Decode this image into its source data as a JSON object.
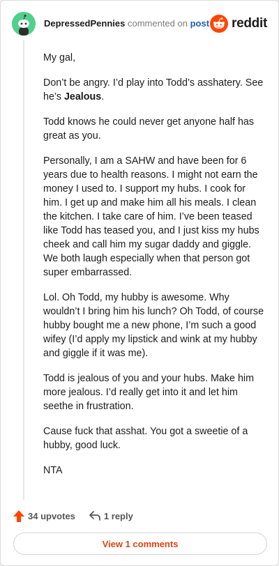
{
  "header": {
    "username": "DepressedPennies",
    "action_text": "commented on",
    "post_link": "post",
    "brand": "reddit"
  },
  "comment": {
    "greeting": "My gal,",
    "p2_pre": "Don’t be angry. I’d play into Todd’s asshatery. See he’s ",
    "p2_bold": "Jealous",
    "p2_post": ".",
    "p3": "Todd knows he could never get anyone half has great as you.",
    "p4": "Personally, I am a SAHW and have been for 6 years due to health reasons. I might not earn the money I used to. I support my hubs. I cook for him. I get up and make him all his meals. I clean the kitchen. I take care of him. I’ve been teased like Todd has teased you, and I just kiss my hubs cheek and call him my sugar daddy and giggle. We both laugh especially when that person got super embarrassed.",
    "p5": "Lol. Oh Todd, my hubby is awesome. Why wouldn’t I bring him his lunch? Oh Todd, of course hubby bought me a new phone, I’m such a good wifey (I’d apply my lipstick and wink at my hubby and giggle if it was me).",
    "p6": "Todd is jealous of you and your hubs. Make him more jealous. I’d really get into it and let him seethe in frustration.",
    "p7": "Cause fuck that asshat. You got a sweetie of a hubby, good luck.",
    "p8": "NTA"
  },
  "actions": {
    "upvotes": "34 upvotes",
    "replies": "1 reply"
  },
  "footer": {
    "view_comments": "View 1 comments"
  },
  "colors": {
    "accent": "#ff4500",
    "link": "#1a5fb4",
    "avatar": "#4fd18b",
    "view_button_text": "#e0430f"
  },
  "icons": {
    "avatar": "snoo-avatar-icon",
    "brand": "reddit-logo-icon",
    "upvote": "upvote-arrow-icon",
    "reply": "reply-arrow-icon"
  }
}
